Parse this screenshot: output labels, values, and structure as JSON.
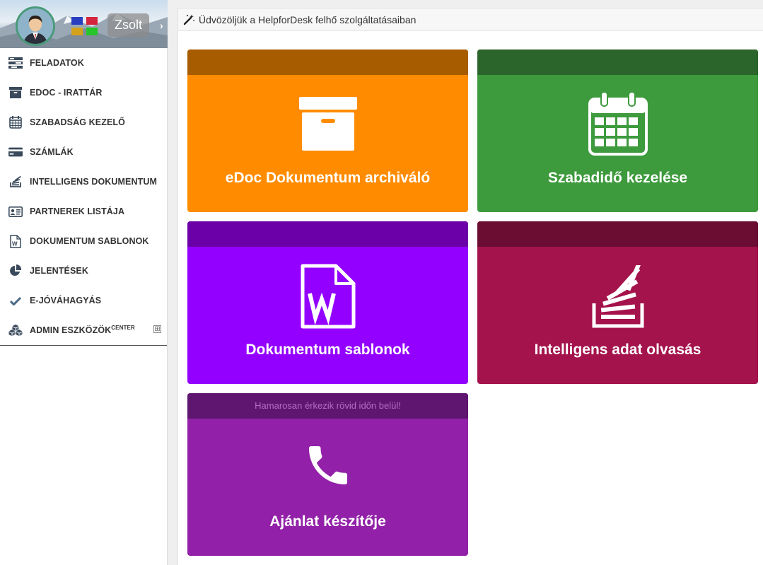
{
  "sidebar": {
    "user": {
      "name": "Zsolt"
    },
    "menu": [
      {
        "label": "FELADATOK",
        "icon": "tasks-list-icon"
      },
      {
        "label": "EDOC - IRATTÁR",
        "icon": "archive-box-icon"
      },
      {
        "label": "SZABADSÁG KEZELŐ",
        "icon": "calendar-icon"
      },
      {
        "label": "SZÁMLÁK",
        "icon": "credit-card-icon"
      },
      {
        "label": "INTELLIGENS DOKUMENTUM",
        "icon": "stack-icon"
      },
      {
        "label": "PARTNEREK LISTÁJA",
        "icon": "contact-card-icon"
      },
      {
        "label": "DOKUMENTUM SABLONOK",
        "icon": "word-file-icon"
      },
      {
        "label": "JELENTÉSEK",
        "icon": "pie-chart-icon"
      },
      {
        "label": "E-JÓVÁHAGYÁS",
        "icon": "checkmark-icon"
      },
      {
        "label": "ADMIN ESZKÖZÖK",
        "sup": "CENTER",
        "icon": "cubes-icon",
        "expand": "⊞"
      }
    ]
  },
  "main": {
    "title": "Üdvözöljük a HelpforDesk felhő szolgáltatásaiban",
    "tiles": [
      {
        "title": "eDoc Dokumentum archiváló",
        "band_text": "",
        "icon": "archive-box-icon",
        "color": "#ff8c00",
        "band_color": "#a85c00"
      },
      {
        "title": "Szabadidő kezelése",
        "band_text": "",
        "icon": "calendar-icon",
        "color": "#3d9a3d",
        "band_color": "#2b652c"
      },
      {
        "title": "Dokumentum sablonok",
        "band_text": "",
        "icon": "word-file-icon",
        "color": "#9300ff",
        "band_color": "#6b00a8"
      },
      {
        "title": "Intelligens adat olvasás",
        "band_text": "",
        "icon": "stack-icon",
        "color": "#a4134c",
        "band_color": "#6b0d33"
      },
      {
        "title": "Ajánlat készítője",
        "band_text": "Hamarosan érkezik rövid időn belül!",
        "icon": "phone-icon",
        "color": "#9220a8",
        "band_color": "#5e1670",
        "band_text_color": "#b46cc6"
      }
    ]
  },
  "colors": {
    "sidebar_icon": "#3a4a5c",
    "accent_check": "#4a6a88"
  }
}
